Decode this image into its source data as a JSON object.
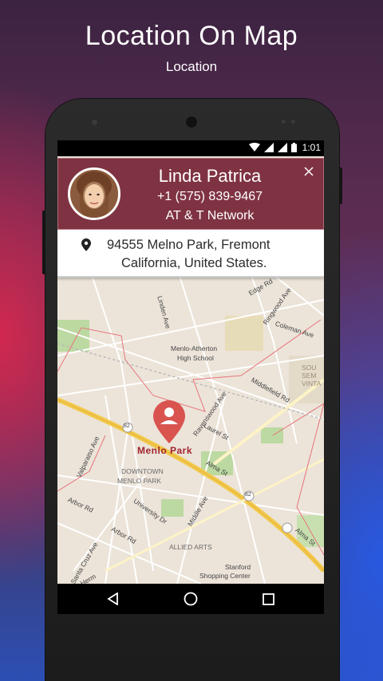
{
  "promo": {
    "title": "Location On Map",
    "subtitle": "Location"
  },
  "status_bar": {
    "time": "1:01",
    "icons": [
      "wifi-icon",
      "signal-icon",
      "signal-icon",
      "battery-icon"
    ]
  },
  "contact_card": {
    "name": "Linda Patrica",
    "phone": "+1 (575) 839-9467",
    "network": "AT & T Network",
    "close_label": "X",
    "background": "#7f3342"
  },
  "address": {
    "line1": "94555 Melno Park, Fremont",
    "line2": "California, United States."
  },
  "map": {
    "marker_label": "Menlo Park",
    "marker_color": "#d9534f",
    "streets": [
      "Linden Ave",
      "Edge Rd",
      "Ringwood Ave",
      "Coleman Ave",
      "Menlo-Atherton",
      "High School",
      "Middlefield Rd",
      "SOU SEM VINTA",
      "Ravenswood Ave",
      "Laurel St",
      "Valparaiso Ave",
      "Alma St",
      "DOWNTOWN",
      "MENLO PARK",
      "Arbor Rd",
      "University Dr",
      "Middle Ave",
      "Arbor Rd",
      "ALLIED ARTS",
      "Santa Cruz Ave",
      "Stanford",
      "Shopping Center",
      "Alma St",
      "82",
      "82",
      "Herm"
    ]
  },
  "nav_bar": {
    "back": "back-icon",
    "home": "home-icon",
    "recents": "recents-icon"
  }
}
